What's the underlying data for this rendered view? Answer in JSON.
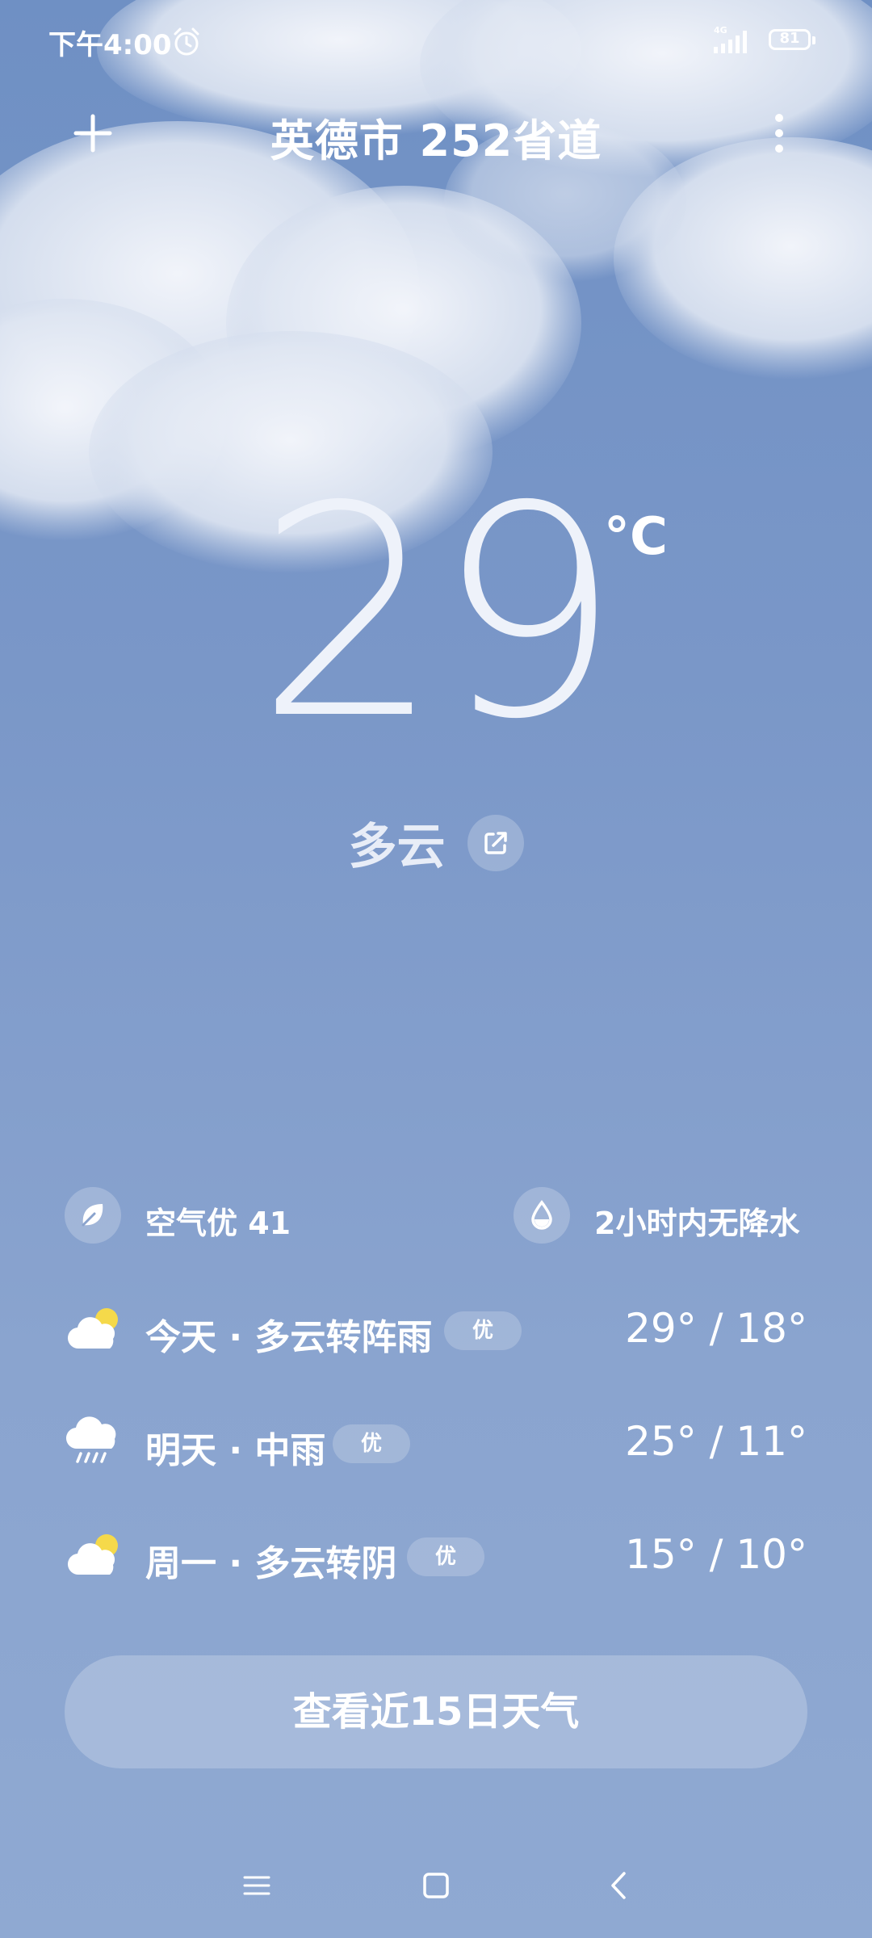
{
  "status_bar": {
    "time": "下午4:00",
    "network": "4G",
    "battery": "81"
  },
  "header": {
    "location": "英德市 252省道"
  },
  "current": {
    "temperature": "29",
    "unit": "°C",
    "condition": "多云"
  },
  "info": {
    "air_quality": "空气优 41",
    "precipitation": "2小时内无降水"
  },
  "forecast": [
    {
      "label": "今天 · 多云转阵雨",
      "aqi": "优",
      "temps": "29° / 18°",
      "icon": "partly-cloudy-icon"
    },
    {
      "label": "明天 · 中雨",
      "aqi": "优",
      "temps": "25° / 11°",
      "icon": "rain-icon"
    },
    {
      "label": "周一 · 多云转阴",
      "aqi": "优",
      "temps": "15° / 10°",
      "icon": "partly-cloudy-icon"
    }
  ],
  "forecast15_label": "查看近15日天气",
  "colors": {
    "sky_top": "#6f90c4",
    "sky_bottom": "#8fa9d2",
    "sun": "#f5d94a"
  }
}
